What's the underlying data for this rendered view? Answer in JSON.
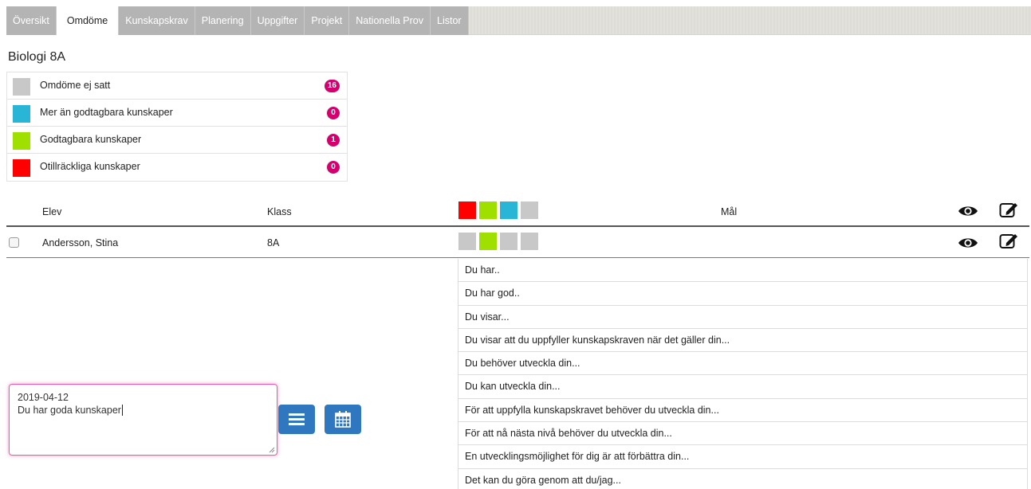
{
  "tabs": [
    {
      "label": "Översikt",
      "active": false
    },
    {
      "label": "Omdöme",
      "active": true
    },
    {
      "label": "Kunskapskrav",
      "active": false
    },
    {
      "label": "Planering",
      "active": false
    },
    {
      "label": "Uppgifter",
      "active": false
    },
    {
      "label": "Projekt",
      "active": false
    },
    {
      "label": "Nationella Prov",
      "active": false
    },
    {
      "label": "Listor",
      "active": false
    }
  ],
  "page_title": "Biologi 8A",
  "legend": [
    {
      "label": "Omdöme ej satt",
      "count": "16",
      "color": "#c8c8c8"
    },
    {
      "label": "Mer än godtagbara kunskaper",
      "count": "0",
      "color": "#29b6d6"
    },
    {
      "label": "Godtagbara kunskaper",
      "count": "1",
      "color": "#9fe000"
    },
    {
      "label": "Otillräckliga kunskaper",
      "count": "0",
      "color": "#ff0000"
    }
  ],
  "table": {
    "headers": {
      "elev": "Elev",
      "klass": "Klass",
      "mal": "Mål"
    },
    "header_swatches": [
      "#ff0000",
      "#9fe000",
      "#29b6d6",
      "#c8c8c8"
    ],
    "rows": [
      {
        "name": "Andersson, Stina",
        "klass": "8A",
        "swatches": [
          "#c8c8c8",
          "#9fe000",
          "#c8c8c8",
          "#c8c8c8"
        ]
      }
    ]
  },
  "comment": {
    "date": "2019-04-12",
    "text": "Du har goda kunskaper"
  },
  "phrases": [
    "Du har..",
    "Du har god..",
    "Du visar...",
    "Du visar att du uppfyller kunskapskraven när det gäller din...",
    "Du behöver utveckla din...",
    "Du kan utveckla din...",
    "För att uppfylla kunskapskravet behöver du utveckla din...",
    "För att nå nästa nivå behöver du utveckla din...",
    "En utvecklingsmöjlighet för dig är att förbättra din...",
    "Det kan du göra genom att du/jag..."
  ],
  "icons": {
    "eye": "eye-icon",
    "edit": "edit-icon",
    "list": "list-icon",
    "calendar": "calendar-icon"
  },
  "colors": {
    "badge": "#d4006d",
    "button": "#2f78bf",
    "focus": "#e65cb4"
  }
}
